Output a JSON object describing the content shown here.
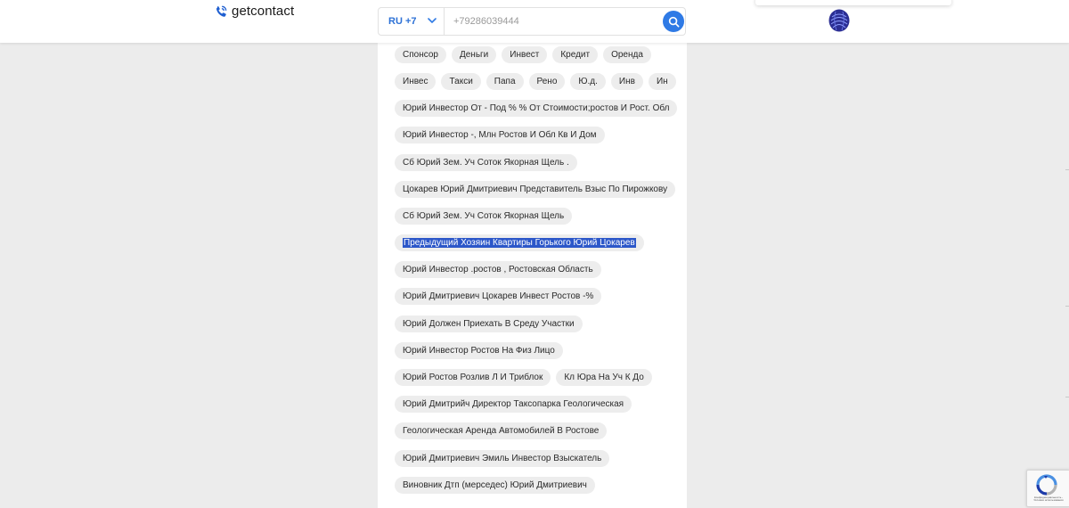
{
  "header": {
    "logo_text": "getcontact",
    "search": {
      "country_code": "RU +7",
      "phone_placeholder": "+79286039444"
    }
  },
  "tags": {
    "rows": [
      [
        "",
        "",
        "",
        ""
      ],
      [
        "Спонсор",
        "Деньги",
        "Инвест",
        "Кредит",
        "Оренда"
      ],
      [
        "Инвес",
        "Такси",
        "Папа",
        "Рено",
        "Ю.д.",
        "Инв",
        "Ин"
      ],
      [
        "Юрий Инвестор От - Под % % От Стоимости;ростов И Рост. Обл"
      ],
      [
        "Юрий Инвестор -, Млн Ростов И Обл Кв И Дом"
      ],
      [
        "Сб Юрий Зем. Уч Соток Якорная Щель ."
      ],
      [
        "Цокарев Юрий Дмитриевич Представитель Взыс По Пирожкову"
      ],
      [
        "Сб Юрий Зем. Уч Соток Якорная Щель"
      ],
      [
        "Предыдущий Хозяин Квартиры Горького Юрий Цокарев"
      ],
      [
        "Юрий Инвестор .ростов , Ростовская Область"
      ],
      [
        "Юрий Дмитриевич Цокарев Инвест Ростов -%"
      ],
      [
        "Юрий Должен Приехать В Среду Участки"
      ],
      [
        "Юрий Инвестор Ростов На Физ Лицо"
      ],
      [
        "Юрий Ростов Розлив Л И Триблок",
        "Кл Юра На Уч К До"
      ],
      [
        "Юрий Дмитрийч Директор Таксопарка Геологическая"
      ],
      [
        "Геологическая Аренда Автомобилей В Ростове"
      ],
      [
        "Юрий Дмитриевич Эмиль Инвестор Взыскатель"
      ],
      [
        "Виновник Дтп (мерседес) Юрий Дмитриевич"
      ]
    ],
    "highlighted_row": 8,
    "first_row_clipped": true
  },
  "recaptcha": {
    "text": "Конфиденциальность - Условия использования"
  },
  "colors": {
    "accent": "#2f7ae5",
    "selection": "#2c57c9",
    "tag_bg": "#ededed",
    "page_bg": "#ececec"
  },
  "icons": {
    "logo": "phone-icon",
    "dropdown": "chevron-down-icon",
    "search": "search-icon",
    "avatar": "avatar",
    "recaptcha": "recaptcha-icon"
  }
}
